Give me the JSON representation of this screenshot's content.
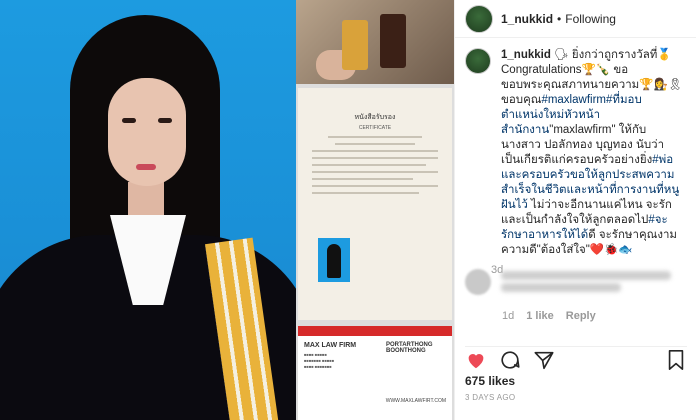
{
  "post": {
    "username": "1_nukkid",
    "follow_status": "Following",
    "caption_parts": {
      "username": "1_nukkid",
      "line1": " 🗣 ยิ่งกว่าถูกรางวัลที่🥇Congratulations🏆🍾 ขอขอบพระคุณสภาทนายความ🏆👩‍⚖️🎗 ขอบคุณ",
      "tag1": "#maxlawfirm",
      "tag2": "#ที่มอบตำแหน่งใหม่หัวหน้าสำนักงาน",
      "line2": "\"maxlawfirm\" ให้กับนางสาว ปอลักทอง บุญทอง นับว่าเป็นเกียรติแก่ครอบครัวอย่างยิ่ง",
      "tag3": "#พ่อและครอบครัวขอให้ลูกประสพความสำเร็จในชีวิตและหน้าที่การงานที่หนูฝันไว้",
      "line3": " ไม่ว่าจะอีกนานแค่ไหน จะรักและเป็นกำลังใจให้ลูกตลอดไป",
      "tag4": "#จะรักษาอาหารให้ได้",
      "line4": "ดี จะรักษาคุณงามความดี\"ต้องใส่ใจ\"❤️🐞🐟"
    },
    "caption_time": "3d",
    "reply": {
      "time": "1d",
      "likes": "1 like",
      "reply_label": "Reply"
    },
    "likes_count": "675 likes",
    "posted_ago": "3 DAYS AGO"
  },
  "media": {
    "certificate_header": "หนังสือรับรอง",
    "certificate_sub": "CERTIFICATE",
    "card_brand": "MAX LAW FIRM",
    "card_brand2": "PORTARTHONG BOONTHONG",
    "card_website": "WWW.MAXLAWFIRT.COM"
  },
  "icons": {
    "like": "heart-icon",
    "comment": "comment-icon",
    "share": "share-icon",
    "save": "bookmark-icon"
  },
  "colors": {
    "like_red": "#ed4956",
    "link_blue": "#003569"
  }
}
